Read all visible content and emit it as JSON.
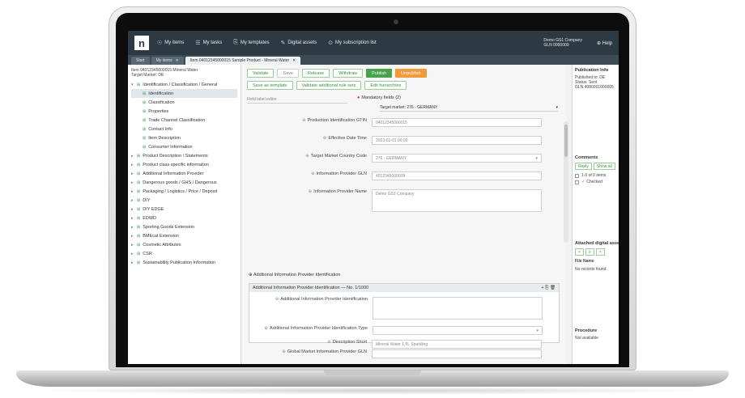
{
  "topbar": {
    "logo": "n",
    "nav": [
      {
        "label": "My items",
        "icon": "☉"
      },
      {
        "label": "My tasks",
        "icon": "☰"
      },
      {
        "label": "My templates",
        "icon": "⎘"
      },
      {
        "label": "Digital assets",
        "icon": "✎"
      },
      {
        "label": "My subscription list",
        "icon": "⊙"
      }
    ],
    "company_line1": "Demo GS1 Company",
    "company_line2": "GLN 0000000",
    "help": "Help"
  },
  "tabs": [
    {
      "label": "Start"
    },
    {
      "label": "My items"
    },
    {
      "label": "Item 04012345000015 Sample Product - Mineral Water"
    }
  ],
  "sidebar": {
    "header_line1": "Item 04012345000015 Mineral Water",
    "header_line2": "Target Market: DE",
    "items": [
      {
        "label": "Identification / Classification / General",
        "level": 0,
        "caret": "▾"
      },
      {
        "label": "Identification",
        "level": 1
      },
      {
        "label": "Classification",
        "level": 1
      },
      {
        "label": "Properties",
        "level": 1
      },
      {
        "label": "Trade Channel Classification",
        "level": 1
      },
      {
        "label": "Contact Info",
        "level": 1
      },
      {
        "label": "Item Description",
        "level": 1
      },
      {
        "label": "Consumer Information",
        "level": 1
      },
      {
        "label": "Product Description / Statements",
        "level": 0,
        "caret": "▸"
      },
      {
        "label": "Product class specific information",
        "level": 0,
        "caret": "▸"
      },
      {
        "label": "Additional Information Provider",
        "level": 0,
        "caret": "▸"
      },
      {
        "label": "Dangerous goods / GHS / Dangerous",
        "level": 0,
        "caret": "▸"
      },
      {
        "label": "Packaging / Logistics / Price / Deposit",
        "level": 0,
        "caret": "▸"
      },
      {
        "label": "DIY",
        "level": 0,
        "caret": "▸"
      },
      {
        "label": "DIY EDGE",
        "level": 0,
        "caret": "▸"
      },
      {
        "label": "EDWD",
        "level": 0,
        "caret": "▸"
      },
      {
        "label": "Sporting Goods Extension",
        "level": 0,
        "caret": "▸"
      },
      {
        "label": "BMEcat Extension",
        "level": 0,
        "caret": "▸"
      },
      {
        "label": "Cosmetic Attributes",
        "level": 0,
        "caret": "▸"
      },
      {
        "label": "CSR",
        "level": 0,
        "caret": "▸"
      },
      {
        "label": "Sustainability Publication Information",
        "level": 0,
        "caret": "▸"
      }
    ]
  },
  "toolbar": {
    "row1": [
      {
        "label": "Validate",
        "style": "green-outline"
      },
      {
        "label": "Save",
        "style": "grey"
      },
      {
        "label": "Release",
        "style": "green-outline"
      },
      {
        "label": "Withdraw",
        "style": "green-outline"
      },
      {
        "label": "Publish",
        "style": "green"
      },
      {
        "label": "Unpublish",
        "style": "orange"
      }
    ],
    "row2": [
      {
        "label": "Save as template",
        "style": "green-outline"
      },
      {
        "label": "Validate additional rule sets",
        "style": "green-outline"
      },
      {
        "label": "Edit hierarchies",
        "style": "green-outline"
      }
    ]
  },
  "language_select": "Field label editor",
  "mandatory_label": "Mandatory fields (2)",
  "target_market": "Target market: 276 - GERMANY",
  "fields": [
    {
      "label": "Production Identification GTIN",
      "value": "04012345000015"
    },
    {
      "label": "Effective Date Time",
      "value": "2023-01-01 00:00"
    },
    {
      "label": "Target Market Country Code",
      "value": "276 - GERMANY"
    },
    {
      "label": "Information Provider GLN",
      "value": "4012345000009"
    },
    {
      "label": "Information Provider Name",
      "value": "Demo GS1 Company"
    }
  ],
  "section_title": "Additional Information Provider Identification",
  "panel": {
    "title": "Additional Information Provider Identification — No. 1/1000",
    "actions": "+ ⎘ 🗑",
    "field1": "Additional Information Provider Identification",
    "field2": "Additional Information Provider Identification Type"
  },
  "bottom_fields": [
    {
      "label": "Global Market Information Provider GLN",
      "value": ""
    },
    {
      "label": "Description Short",
      "value": "Mineral Water 1,5L Sparkling"
    }
  ],
  "right_panel": {
    "pub_title": "Publication Info",
    "pub_line1": "Published to: DE",
    "pub_line2": "Status: Sent",
    "pub_line3": "GLN 4000001000005",
    "comments_title": "Comments",
    "comment_btn1": "Reply",
    "comment_btn2": "Show all",
    "comment_row1": "1-0 of 0 items",
    "comment_row2": "Checked",
    "assets_title": "Attached digital assets",
    "assets_header": "File Name",
    "assets_empty": "No records found.",
    "prov_title": "Procedure",
    "prov_text": "Not available"
  }
}
